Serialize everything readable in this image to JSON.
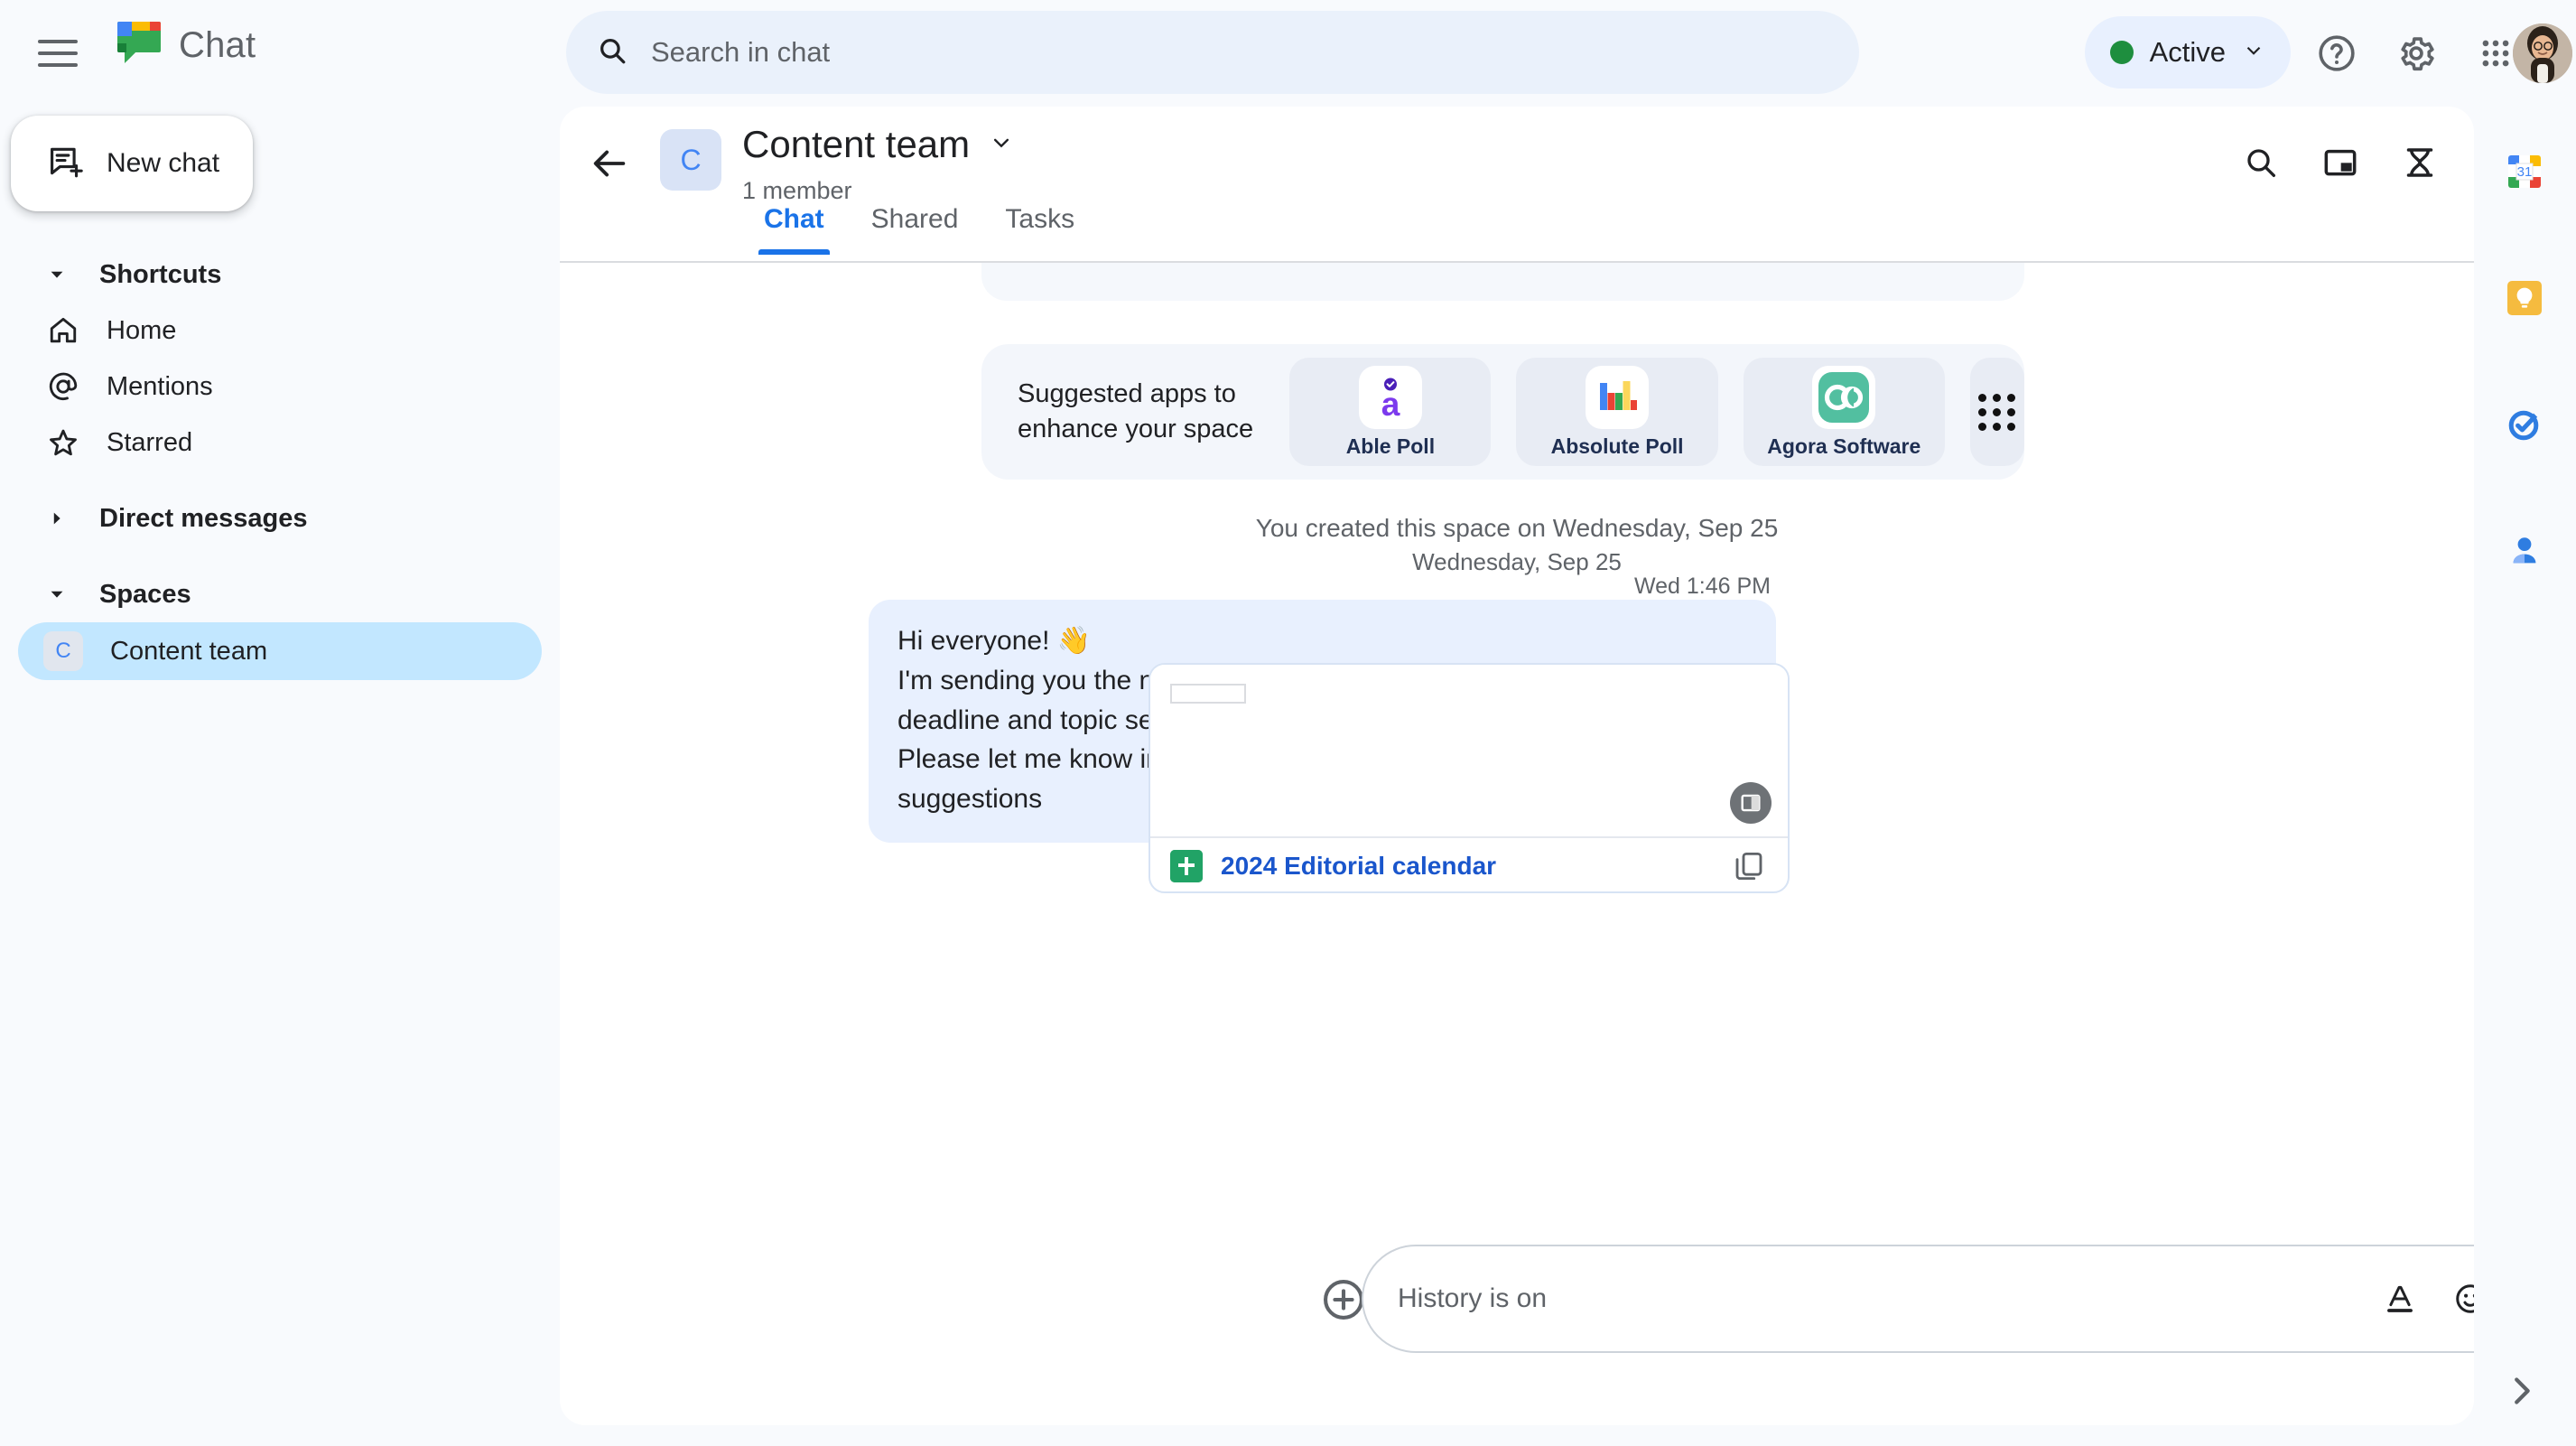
{
  "app": {
    "brand": "Chat",
    "logo_icon": "google-chat-logo"
  },
  "topbar": {
    "menu_icon": "hamburger-menu-icon",
    "search": {
      "icon": "search-icon",
      "placeholder": "Search in chat",
      "value": ""
    },
    "status": {
      "label": "Active",
      "dot_color": "#1e8e3e",
      "chevron_icon": "chevron-down-icon"
    },
    "help_icon": "help-circle-icon",
    "settings_icon": "gear-icon",
    "apps_grid_icon": "apps-grid-icon",
    "avatar_icon": "user-avatar"
  },
  "sidebar": {
    "new_chat": {
      "label": "New chat",
      "icon": "new-chat-icon"
    },
    "shortcuts": {
      "title": "Shortcuts",
      "caret_icon": "caret-down-icon",
      "items": [
        {
          "label": "Home",
          "icon": "home-icon"
        },
        {
          "label": "Mentions",
          "icon": "at-mention-icon"
        },
        {
          "label": "Starred",
          "icon": "star-icon"
        }
      ]
    },
    "direct_messages": {
      "title": "Direct messages",
      "caret_icon": "caret-right-icon"
    },
    "spaces": {
      "title": "Spaces",
      "caret_icon": "caret-down-icon",
      "items": [
        {
          "label": "Content team",
          "initial": "C",
          "active": true
        }
      ]
    }
  },
  "conversation": {
    "back_icon": "back-arrow-icon",
    "avatar_initial": "C",
    "title": "Content team",
    "title_chevron_icon": "chevron-down-icon",
    "member_count": "1 member",
    "actions": [
      {
        "icon": "search-icon",
        "name": "search-in-conversation-button"
      },
      {
        "icon": "picture-in-picture-icon",
        "name": "picture-in-picture-button"
      },
      {
        "icon": "hourglass-icon",
        "name": "message-history-button"
      }
    ],
    "tabs": [
      {
        "label": "Chat",
        "active": true
      },
      {
        "label": "Shared",
        "active": false
      },
      {
        "label": "Tasks",
        "active": false
      }
    ]
  },
  "suggested_apps": {
    "heading_line1": "Suggested apps to",
    "heading_line2": "enhance your space",
    "apps": [
      {
        "name": "Able Poll",
        "icon": "able-poll-icon"
      },
      {
        "name": "Absolute Poll",
        "icon": "absolute-poll-icon"
      },
      {
        "name": "Agora Software",
        "icon": "agora-software-icon"
      }
    ],
    "more_icon": "apps-grid-icon"
  },
  "messages": {
    "system_note": "You created this space on Wednesday, Sep 25",
    "day_separator": "Wednesday, Sep 25",
    "items": [
      {
        "timestamp": "Wed 1:46 PM",
        "lines": [
          "Hi everyone! 👋",
          "I'm sending you the newest content calendar with the updated deadline and topic sections.",
          "Please let me know in the thread below if you have any questions or suggestions"
        ],
        "attachment": {
          "file_name": "2024 Editorial calendar",
          "file_icon": "google-sheets-icon",
          "copy_icon": "copy-link-icon",
          "overlay_icon": "picture-in-picture-icon"
        }
      }
    ]
  },
  "composer": {
    "add_icon": "plus-circle-icon",
    "placeholder": "History is on",
    "value": "",
    "tools": [
      {
        "icon": "format-text-icon",
        "name": "format-button"
      },
      {
        "icon": "emoji-icon",
        "name": "emoji-button"
      },
      {
        "icon": "gif-icon",
        "name": "gif-button"
      },
      {
        "icon": "upload-file-icon",
        "name": "upload-file-button"
      },
      {
        "icon": "add-video-meeting-icon",
        "name": "video-meeting-button"
      }
    ],
    "send_icon": "send-icon"
  },
  "right_rail": {
    "items": [
      {
        "icon": "google-calendar-icon",
        "name": "calendar-panel-button",
        "badge": "31"
      },
      {
        "icon": "google-keep-icon",
        "name": "keep-panel-button"
      },
      {
        "icon": "google-tasks-icon",
        "name": "tasks-panel-button"
      },
      {
        "icon": "google-contacts-icon",
        "name": "contacts-panel-button"
      }
    ],
    "expand_icon": "chevron-right-icon"
  },
  "colors": {
    "accent_blue": "#1a73e8",
    "bubble_bg": "#e8f0fe",
    "active_space": "#c2e7ff",
    "status_green": "#1e8e3e",
    "sheets_green": "#21a366"
  }
}
